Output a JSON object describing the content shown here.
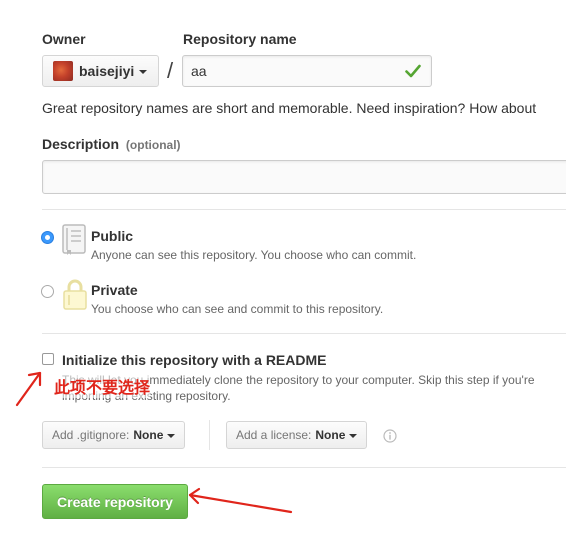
{
  "owner": {
    "label": "Owner",
    "selected": "baisejiyi"
  },
  "repository": {
    "label": "Repository name",
    "slash": "/",
    "value": "aa",
    "hint": "Great repository names are short and memorable. Need inspiration? How about"
  },
  "description": {
    "label": "Description",
    "optional": "(optional)",
    "value": ""
  },
  "visibility": {
    "selected": "public",
    "public": {
      "title": "Public",
      "description": "Anyone can see this repository. You choose who can commit."
    },
    "private": {
      "title": "Private",
      "description": "You choose who can see and commit to this repository."
    }
  },
  "readme": {
    "checked": false,
    "title": "Initialize this repository with a README",
    "description": "This will let you immediately clone the repository to your computer. Skip this step if you're importing an existing repository."
  },
  "annotation": {
    "text": "此项不要选择",
    "color": "#e0251b"
  },
  "gitignore": {
    "label": "Add .gitignore:",
    "value": "None"
  },
  "license": {
    "label": "Add a license:",
    "value": "None"
  },
  "submit": {
    "label": "Create repository"
  },
  "colors": {
    "create_button": "#60b044",
    "radio_selected": "#3b99fc",
    "valid_check": "#55a532",
    "annotation_red": "#e0251b"
  }
}
